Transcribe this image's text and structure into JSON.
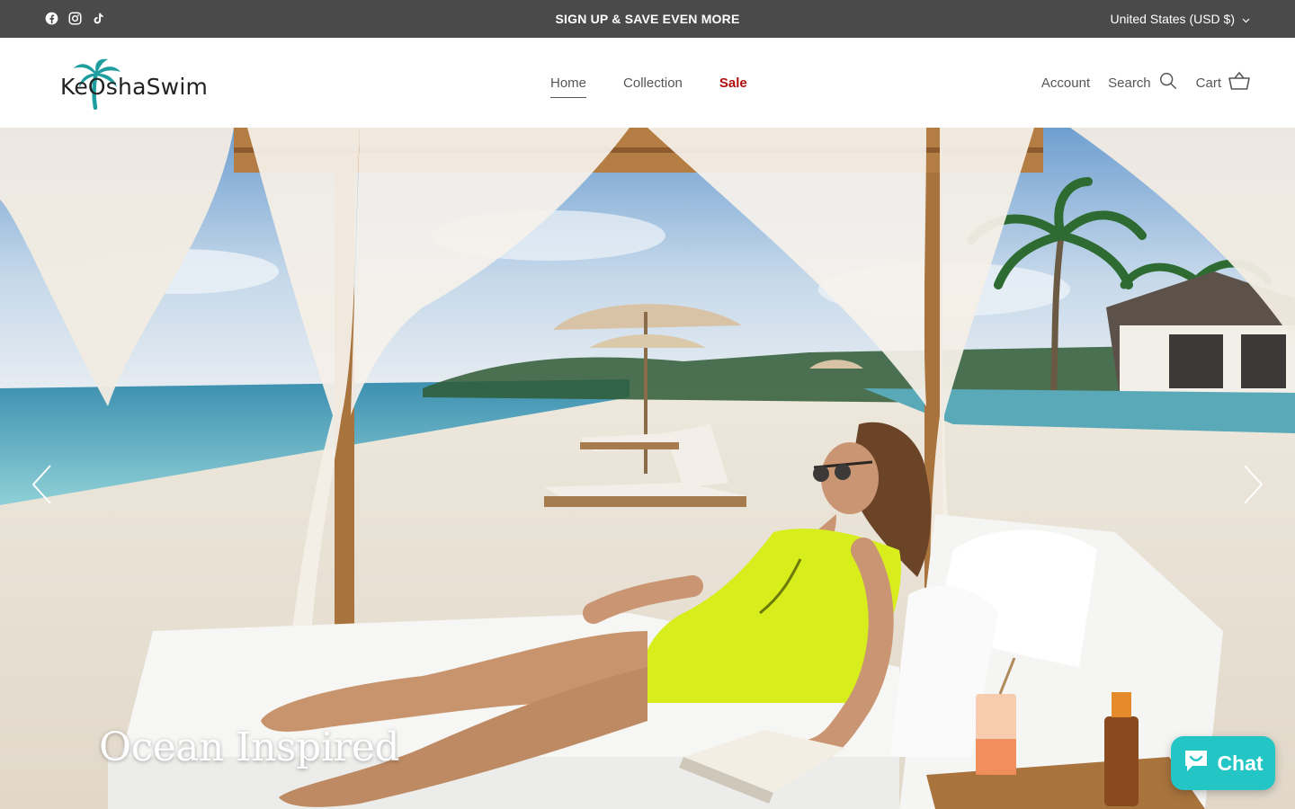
{
  "announcement": {
    "text": "SIGN UP & SAVE EVEN MORE",
    "social_icons": [
      "facebook-icon",
      "instagram-icon",
      "tiktok-icon"
    ],
    "locale": "United States (USD $)"
  },
  "header": {
    "logo_text": "KeOshaSwim",
    "nav": [
      {
        "label": "Home",
        "active": true
      },
      {
        "label": "Collection",
        "active": false
      },
      {
        "label": "Sale",
        "active": false
      }
    ],
    "account_label": "Account",
    "search_label": "Search",
    "cart_label": "Cart"
  },
  "hero": {
    "title": "Ocean Inspired"
  },
  "chat": {
    "label": "Chat"
  },
  "colors": {
    "announcement_bg": "#4a4a4a",
    "sale": "#b00d0d",
    "chat": "#23c5c5",
    "logo_palm": "#1f9ea0"
  }
}
